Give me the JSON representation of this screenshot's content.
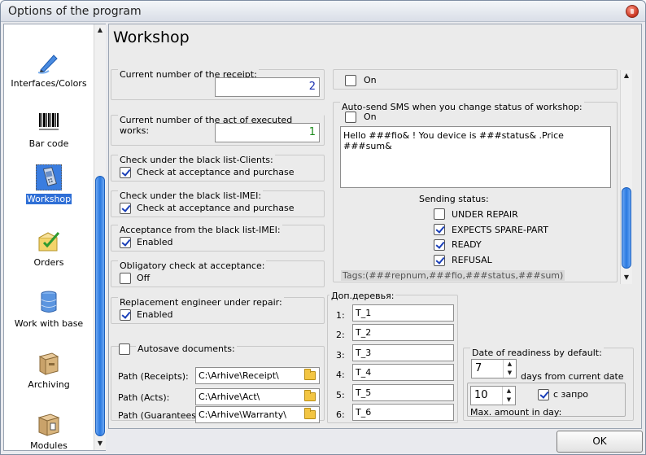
{
  "window": {
    "title": "Options of the program"
  },
  "sidebar": {
    "items": [
      {
        "label": "Interfaces/Colors",
        "icon": "pen-icon"
      },
      {
        "label": "Bar code",
        "icon": "barcode-icon"
      },
      {
        "label": "Workshop",
        "icon": "phone-icon",
        "selected": true
      },
      {
        "label": "Orders",
        "icon": "orders-icon"
      },
      {
        "label": "Work with base",
        "icon": "database-icon"
      },
      {
        "label": "Archiving",
        "icon": "archive-icon"
      },
      {
        "label": "Modules",
        "icon": "modules-icon"
      }
    ]
  },
  "main": {
    "title": "Workshop",
    "receipt": {
      "label": "Current number of the receipt:",
      "value": "2"
    },
    "act": {
      "label": "Current number of the act of executed works:",
      "value": "1"
    },
    "blacklist_clients": {
      "label": "Check under the black list-Clients:",
      "check_label": "Check at acceptance and purchase",
      "checked": true
    },
    "blacklist_imei": {
      "label": "Check under the black list-IMEI:",
      "check_label": "Check at acceptance and purchase",
      "checked": true
    },
    "acceptance_imei": {
      "label": "Acceptance from the black list-IMEI:",
      "check_label": "Enabled",
      "checked": true
    },
    "obligatory": {
      "label": "Obligatory check at acceptance:",
      "check_label": "Off",
      "checked": false
    },
    "replacement": {
      "label": "Replacement engineer under repair:",
      "check_label": "Enabled",
      "checked": true
    },
    "autosave": {
      "label": "Autosave documents:",
      "checked": false,
      "paths": [
        {
          "label": "Path (Receipts):",
          "value": "C:\\Arhive\\Receipt\\"
        },
        {
          "label": "Path (Acts):",
          "value": "C:\\Arhive\\Act\\"
        },
        {
          "label": "Path (Guarantees):",
          "value": "C:\\Arhive\\Warranty\\"
        }
      ]
    },
    "sms_top": {
      "check_label": "On",
      "checked": false
    },
    "sms_status": {
      "label": "Auto-send SMS when you change status of workshop:",
      "check_label": "On",
      "checked": false,
      "message": "Hello ###fio& ! You device is ###status& .Price ###sum&",
      "sending_label": "Sending status:",
      "statuses": [
        {
          "label": "UNDER REPAIR",
          "checked": false
        },
        {
          "label": "EXPECTS SPARE-PART",
          "checked": true
        },
        {
          "label": "READY",
          "checked": true
        },
        {
          "label": "REFUSAL",
          "checked": true
        }
      ],
      "tags": "Tags:(###repnum,###fio,###status,###sum)"
    },
    "trees": {
      "label": "Доп.деревья:",
      "rows": [
        {
          "num": "1:",
          "value": "T_1"
        },
        {
          "num": "2:",
          "value": "T_2"
        },
        {
          "num": "3:",
          "value": "T_3"
        },
        {
          "num": "4:",
          "value": "T_4"
        },
        {
          "num": "5:",
          "value": "T_5"
        },
        {
          "num": "6:",
          "value": "T_6"
        }
      ]
    },
    "readiness": {
      "label": "Date of readiness by default:",
      "days_value": "7",
      "days_label": "days from current date",
      "max_value": "10",
      "max_label": "Max. amount in day:",
      "request_label": "с запро",
      "request_checked": true
    }
  },
  "footer": {
    "ok_label": "OK"
  }
}
